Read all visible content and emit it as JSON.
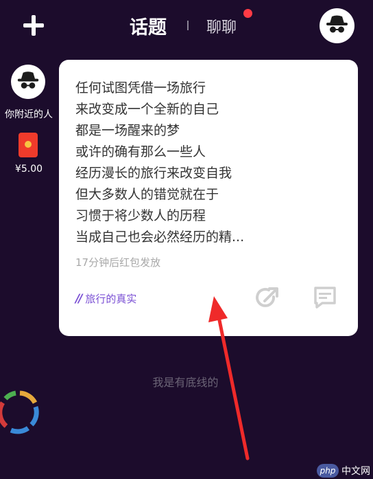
{
  "header": {
    "tabs": [
      {
        "label": "话题",
        "active": true
      },
      {
        "label": "聊聊",
        "active": false,
        "has_notification_dot": true
      }
    ],
    "add_icon": "plus-icon",
    "avatar_icon": "incognito-avatar-icon"
  },
  "sidebar": {
    "nearby_label": "你附近的人",
    "red_packet_amount": "¥5.00",
    "red_packet_icon": "red-envelope-icon"
  },
  "card": {
    "lines": [
      "任何试图凭借一场旅行",
      "来改变成一个全新的自己",
      "都是一场醒来的梦",
      "或许的确有那么一些人",
      "经历漫长的旅行来改变自我",
      "但大多数人的错觉就在于",
      "习惯于将少数人的历程",
      "当成自己也会必然经历的精..."
    ],
    "countdown": "17分钟后红包发放",
    "topic_tag": "旅行的真实",
    "share_icon": "share-icon",
    "comment_icon": "comment-icon"
  },
  "footer": {
    "text": "我是有底线的"
  },
  "watermark": {
    "badge": "php",
    "text": "中文网"
  },
  "colors": {
    "background": "#1c0c2c",
    "card": "#ffffff",
    "accent": "#7a4fd4",
    "notification": "#ff3b45",
    "arrow": "#ef2a2a"
  }
}
